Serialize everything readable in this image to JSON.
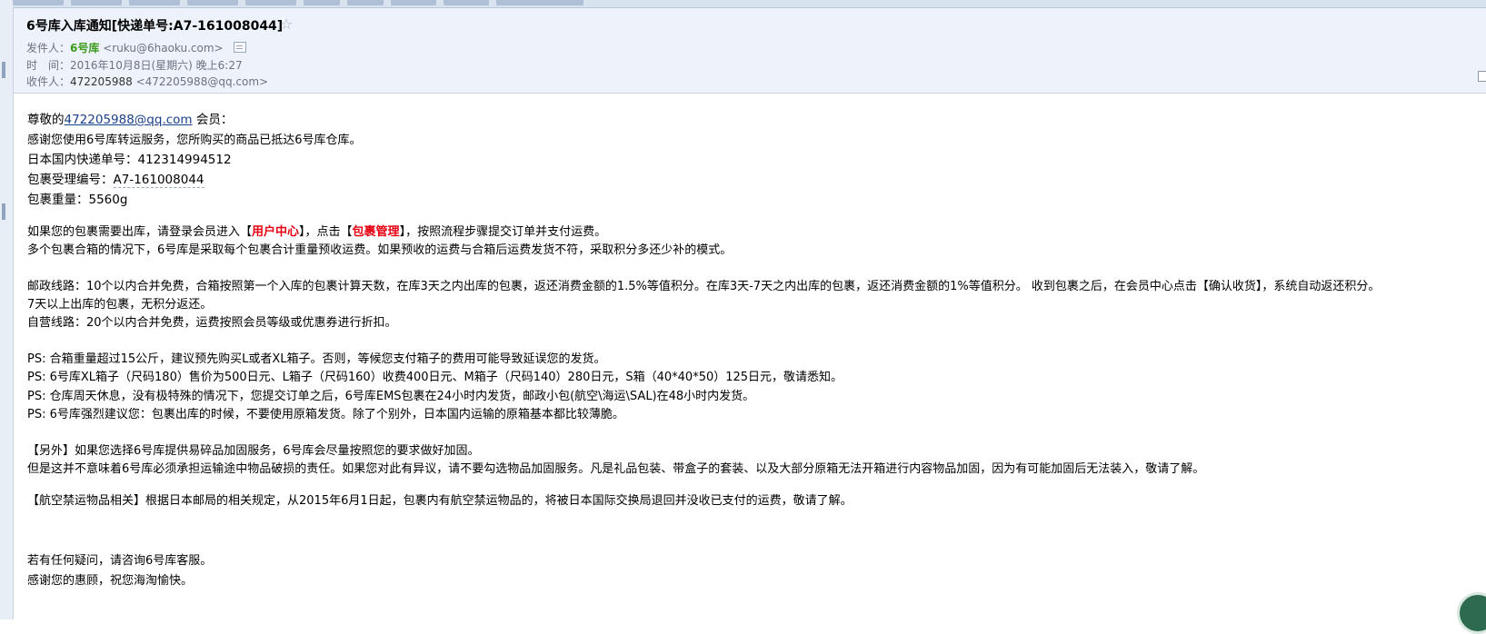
{
  "header": {
    "subject": "6号库入库通知[快递单号:A7-161008044]",
    "sender_label": "发件人：",
    "sender_name": "6号库",
    "sender_email": "<ruku@6haoku.com>",
    "time_label": "时　间：",
    "time_value": "2016年10月8日(星期六) 晚上6:27",
    "recipient_label": "收件人：",
    "recipient_name": "472205988",
    "recipient_email": "<472205988@qq.com>"
  },
  "body": {
    "greeting_pre": "尊敬的",
    "greeting_email": "472205988@qq.com",
    "greeting_post": " 会员：",
    "thanks": "感谢您使用6号库转运服务，您所购买的商品已抵达6号库仓库。",
    "tracking_label": "日本国内快递单号：",
    "tracking_value": "412314994512",
    "package_id_label": "包裹受理编号：",
    "package_id_value": "A7-161008044",
    "weight_label": "包裹重量：",
    "weight_value": "5560g",
    "ship_pre": "如果您的包裹需要出库，请登录会员进入【",
    "ship_link1": "用户中心",
    "ship_mid": "】，点击【",
    "ship_link2": "包裹管理",
    "ship_post": "】，按照流程步骤提交订单并支付运费。",
    "merge_note": "多个包裹合箱的情况下，6号库是采取每个包裹合计重量预收运费。如果预收的运费与合箱后运费发货不符，采取积分多还少补的模式。",
    "mail_line1": "邮政线路：10个以内合并免费，合箱按照第一个入库的包裹计算天数，在库3天之内出库的包裹，返还消费金额的1.5%等值积分。在库3天-7天之内出库的包裹，返还消费金额的1%等值积分。 收到包裹之后，在会员中心点击【确认收货】，系统自动返还积分。",
    "mail_line2": "7天以上出库的包裹，无积分返还。",
    "self_line": "自营线路：20个以内合并免费，运费按照会员等级或优惠券进行折扣。",
    "ps1": "PS: 合箱重量超过15公斤，建议预先购买L或者XL箱子。否则，等候您支付箱子的费用可能导致延误您的发货。",
    "ps2": "PS: 6号库XL箱子（尺码180）售价为500日元、L箱子（尺码160）收费400日元、M箱子（尺码140）280日元，S箱（40*40*50）125日元，敬请悉知。",
    "ps3": "PS: 仓库周天休息，没有极特殊的情况下，您提交订单之后，6号库EMS包裹在24小时内发货，邮政小包(航空\\海运\\SAL)在48小时内发货。",
    "ps4": "PS: 6号库强烈建议您：包裹出库的时候，不要使用原箱发货。除了个别外，日本国内运输的原箱基本都比较薄脆。",
    "extra1": "【另外】如果您选择6号库提供易碎品加固服务，6号库会尽量按照您的要求做好加固。",
    "extra2": "但是这并不意味着6号库必须承担运输途中物品破损的责任。如果您对此有异议，请不要勾选物品加固服务。凡是礼品包装、带盒子的套装、以及大部分原箱无法开箱进行内容物品加固，因为有可能加固后无法装入，敬请了解。",
    "air_notice": "【航空禁运物品相关】根据日本邮局的相关规定，从2015年6月1日起，包裹内有航空禁运物品的，将被日本国际交换局退回并没收已支付的运费，敬请了解。",
    "closing1": "若有任何疑问，请咨询6号库客服。",
    "closing2": "感谢您的惠顾，祝您海淘愉快。"
  }
}
